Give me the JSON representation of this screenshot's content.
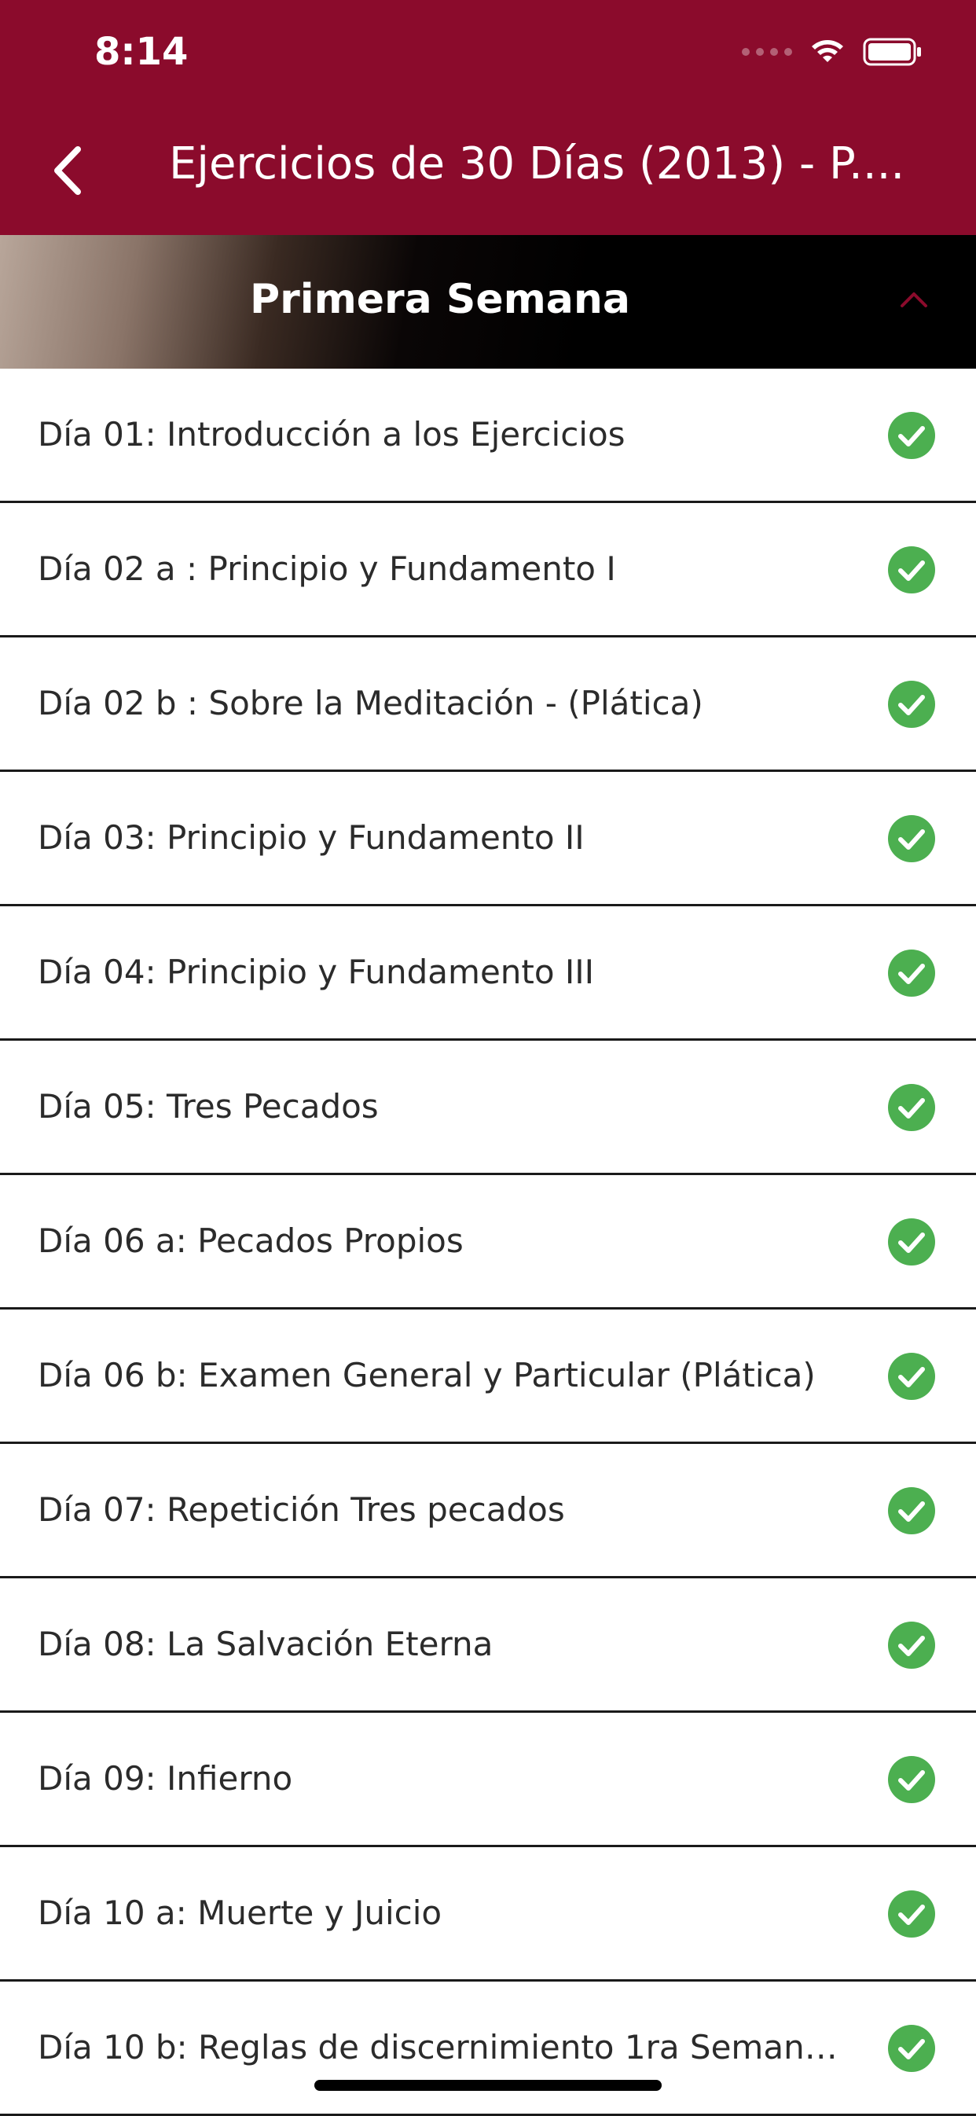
{
  "status_bar": {
    "time": "8:14"
  },
  "nav": {
    "title": "Ejercicios de 30 Días (2013) - P...."
  },
  "section": {
    "title": "Primera Semana"
  },
  "items": [
    {
      "label": "Día 01: Introducción a los Ejercicios"
    },
    {
      "label": "Día 02 a : Principio y Fundamento I"
    },
    {
      "label": "Día 02 b : Sobre la Meditación - (Plática)"
    },
    {
      "label": "Día 03: Principio y Fundamento II"
    },
    {
      "label": "Día 04: Principio y Fundamento III"
    },
    {
      "label": "Día 05: Tres Pecados"
    },
    {
      "label": "Día 06 a: Pecados Propios"
    },
    {
      "label": "Día 06 b: Examen General y Particular (Plática)"
    },
    {
      "label": "Día 07: Repetición Tres pecados"
    },
    {
      "label": "Día 08: La Salvación Eterna"
    },
    {
      "label": "Día 09: Infierno"
    },
    {
      "label": "Día 10 a: Muerte y Juicio"
    },
    {
      "label": "Día 10 b: Reglas de discernimiento 1ra Semana..."
    }
  ],
  "colors": {
    "header": "#8b0b2c",
    "check": "#4caf50",
    "chevron": "#8b0b2c"
  }
}
